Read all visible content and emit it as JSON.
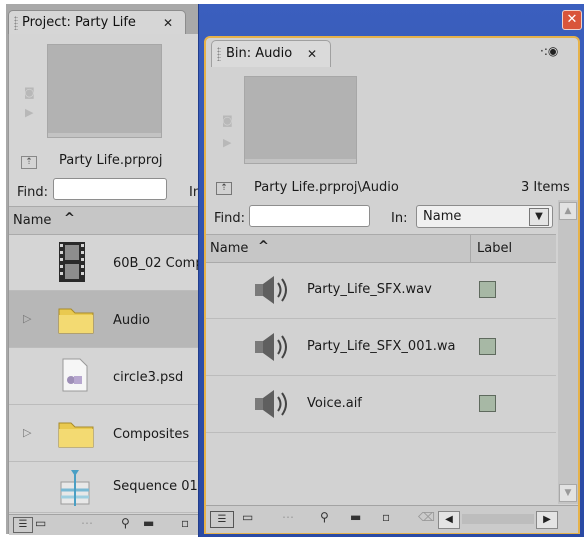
{
  "project_panel": {
    "tab_title": "Project: Party Life",
    "file_name": "Party Life.prproj",
    "find_label": "Find:",
    "in_label": "In",
    "column_name": "Name",
    "items": [
      {
        "label": "60B_02 Comp",
        "icon": "film-icon"
      },
      {
        "label": "Audio",
        "icon": "folder-icon"
      },
      {
        "label": "circle3.psd",
        "icon": "psd-file-icon"
      },
      {
        "label": "Composites",
        "icon": "folder-icon"
      },
      {
        "label": "Sequence 01",
        "icon": "sequence-icon"
      }
    ]
  },
  "bin_panel": {
    "tab_title": "Bin: Audio",
    "path": "Party Life.prproj\\Audio",
    "item_count": "3 Items",
    "find_label": "Find:",
    "in_label": "In:",
    "in_select": "Name",
    "column_name": "Name",
    "column_label": "Label",
    "items": [
      {
        "label": "Party_Life_SFX.wav"
      },
      {
        "label": "Party_Life_SFX_001.wa"
      },
      {
        "label": "Voice.aif"
      }
    ],
    "label_color": "#a7b8a5"
  },
  "window": {
    "accent": "#2f51ad",
    "close_color": "#d9553a",
    "bin_border": "#e6b24a"
  }
}
